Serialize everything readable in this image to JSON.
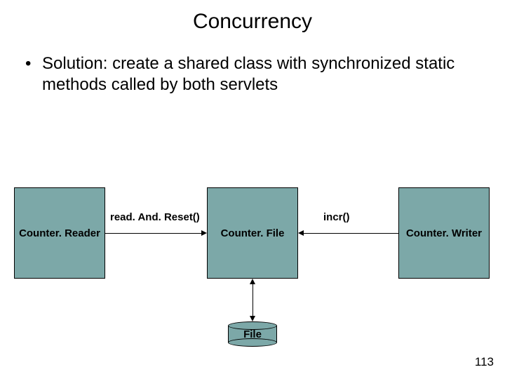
{
  "title": "Concurrency",
  "bullet": "Solution: create a shared class with synchronized static methods called by both servlets",
  "diagram": {
    "boxes": {
      "left": "Counter. Reader",
      "center": "Counter. File",
      "right": "Counter. Writer"
    },
    "edges": {
      "left_label": "read. And. Reset()",
      "right_label": "incr()"
    },
    "storage_label": "File"
  },
  "page_number": "113"
}
